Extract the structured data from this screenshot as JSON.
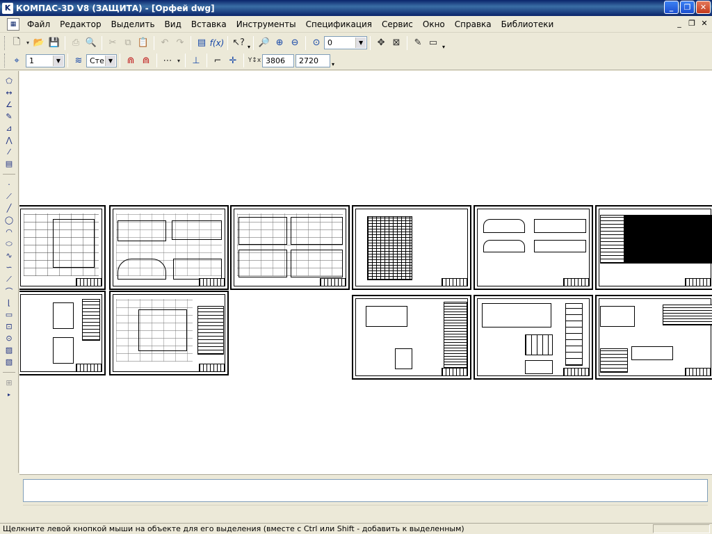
{
  "window": {
    "title": "КОМПАС-3D V8 (ЗАЩИТА) - [Орфей dwg]",
    "app_icon": "kompas-icon"
  },
  "menu": {
    "items": [
      {
        "label": "Файл"
      },
      {
        "label": "Редактор"
      },
      {
        "label": "Выделить"
      },
      {
        "label": "Вид"
      },
      {
        "label": "Вставка"
      },
      {
        "label": "Инструменты"
      },
      {
        "label": "Спецификация"
      },
      {
        "label": "Сервис"
      },
      {
        "label": "Окно"
      },
      {
        "label": "Справка"
      },
      {
        "label": "Библиотеки"
      }
    ]
  },
  "toolbar_main": {
    "zoom_value": "0"
  },
  "toolbar_current": {
    "layer_value": "1",
    "style_value": "Сте",
    "coord_x": "3806",
    "coord_y": "2720"
  },
  "status": {
    "message": "Щелкните левой кнопкой мыши на объекте для его выделения (вместе с Ctrl или Shift - добавить к выделенным)"
  }
}
